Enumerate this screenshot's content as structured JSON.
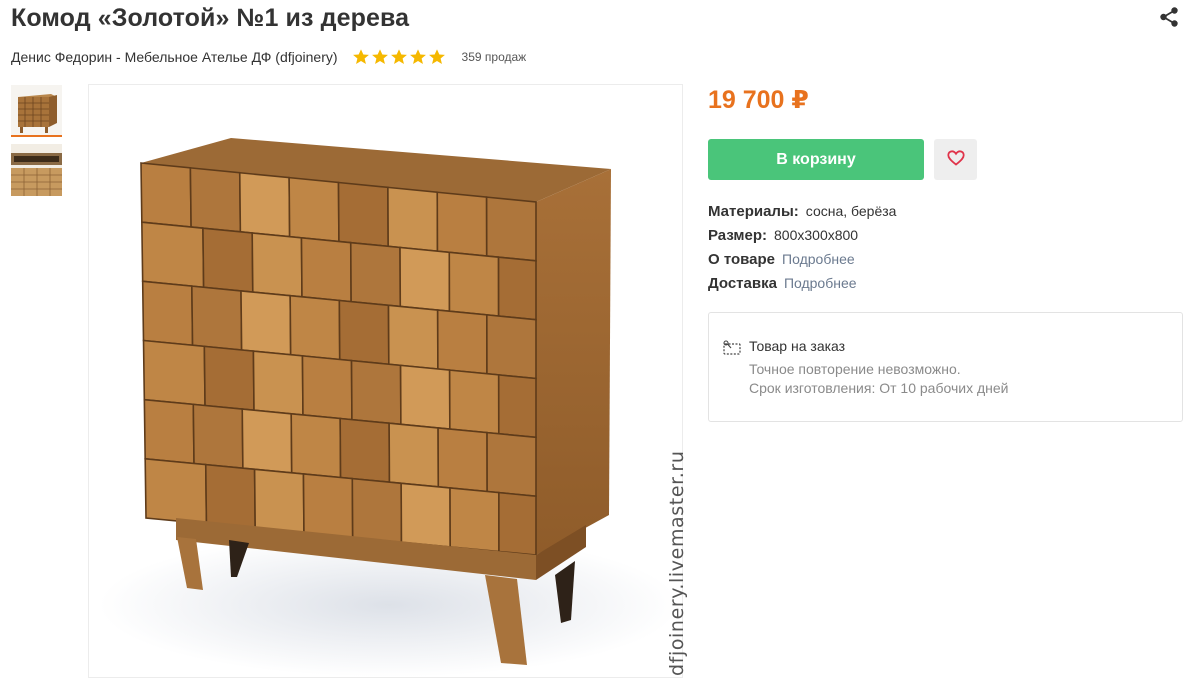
{
  "product": {
    "title": "Комод «Золотой» №1 из дерева",
    "seller": "Денис Федорин - Мебельное Ателье ДФ (dfjoinery)",
    "rating_stars": 5,
    "rating_max": 5,
    "sales": "359 продаж",
    "price": "19 700 ₽",
    "watermark": "dfjoinery.livemaster.ru"
  },
  "actions": {
    "cart_label": "В корзину",
    "share_icon": "share-icon",
    "favorite_icon": "heart-icon"
  },
  "properties": [
    {
      "label": "Материалы:",
      "value": "сосна, берёза"
    },
    {
      "label": "Размер:",
      "value": "800x300x800"
    },
    {
      "label": "О товаре",
      "link": "Подробнее"
    },
    {
      "label": "Доставка",
      "link": "Подробнее"
    }
  ],
  "order_info": {
    "title": "Товар на заказ",
    "line1": "Точное повторение невозможно.",
    "line2": "Срок изготовления: От 10 рабочих дней"
  },
  "colors": {
    "accent": "#e8721e",
    "cart_button": "#4ac57a",
    "star": "#f5b800",
    "link": "#6b7a8f"
  }
}
